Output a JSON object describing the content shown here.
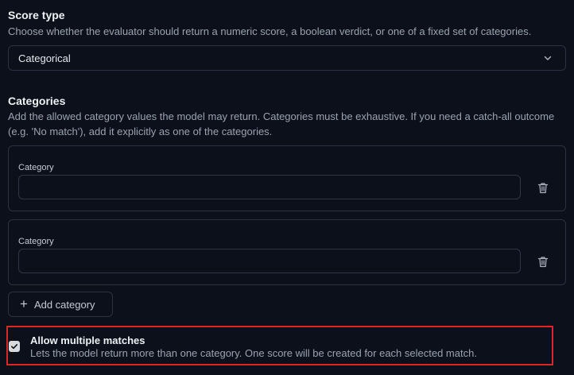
{
  "score_type": {
    "title": "Score type",
    "description": "Choose whether the evaluator should return a numeric score, a boolean verdict, or one of a fixed set of categories.",
    "selected": "Categorical",
    "chevron_icon": "chevron-down-icon"
  },
  "categories": {
    "title": "Categories",
    "description": "Add the allowed category values the model may return. Categories must be exhaustive. If you need a catch-all outcome (e.g. 'No match'), add it explicitly as one of the categories.",
    "items": [
      {
        "label": "Category",
        "value": "",
        "delete_icon": "trash-icon"
      },
      {
        "label": "Category",
        "value": "",
        "delete_icon": "trash-icon"
      }
    ],
    "add_label": "Add category",
    "add_icon": "plus-icon"
  },
  "allow_multiple": {
    "title": "Allow multiple matches",
    "description": "Lets the model return more than one category. One score will be created for each selected match.",
    "checked": true,
    "highlight_color": "#d8262b"
  },
  "colors": {
    "background": "#0b101b",
    "border": "#2a3140",
    "muted_text": "#9aa3b0",
    "highlight": "#d8262b"
  }
}
